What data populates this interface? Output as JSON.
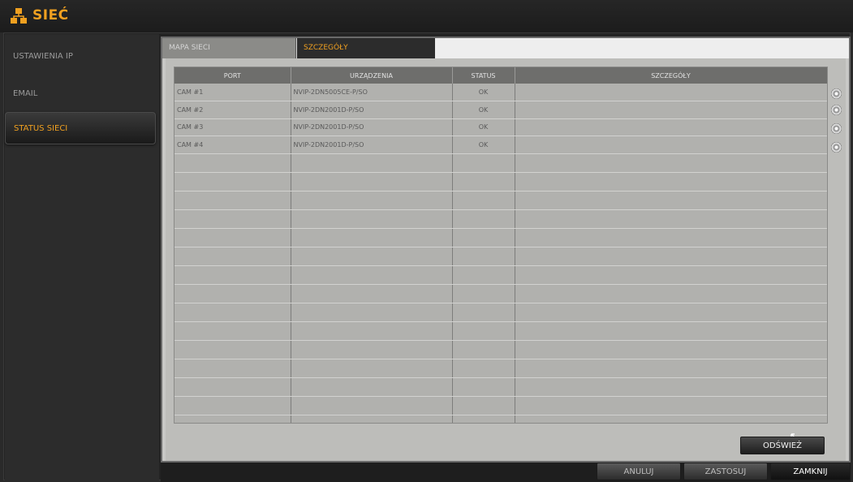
{
  "window": {
    "title": "SIEĆ"
  },
  "sidebar": {
    "items": [
      {
        "label": "USTAWIENIA IP"
      },
      {
        "label": "EMAIL"
      },
      {
        "label": "STATUS SIECI"
      }
    ],
    "active_index": 2
  },
  "tabs": [
    {
      "label": "MAPA SIECI"
    },
    {
      "label": "SZCZEGÓŁY"
    }
  ],
  "active_tab": 1,
  "table": {
    "columns": [
      "PORT",
      "URZĄDZENIA",
      "STATUS",
      "SZCZEGÓŁY"
    ],
    "rows": [
      {
        "port": "CAM #1",
        "device": "NVIP-2DN5005CE-P/SO",
        "status": "OK",
        "details": ""
      },
      {
        "port": "CAM #2",
        "device": "NVIP-2DN2001D-P/SO",
        "status": "OK",
        "details": ""
      },
      {
        "port": "CAM #3",
        "device": "NVIP-2DN2001D-P/SO",
        "status": "OK",
        "details": ""
      },
      {
        "port": "CAM #4",
        "device": "NVIP-2DN2001D-P/SO",
        "status": "OK",
        "details": ""
      }
    ],
    "row_action_icon": "gear-icon"
  },
  "buttons": {
    "refresh": "ODŚWIEŻ",
    "cancel": "ANULUJ",
    "apply": "ZASTOSUJ",
    "close": "ZAMKNIJ"
  },
  "colors": {
    "accent": "#f0a020",
    "panel": "#c8c8c6",
    "dark": "#2a2a2a"
  }
}
